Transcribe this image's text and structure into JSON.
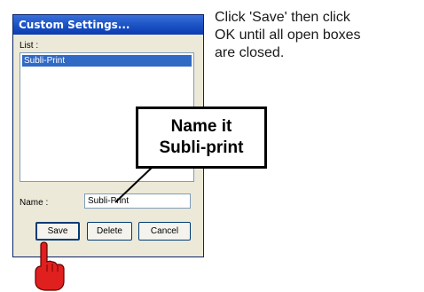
{
  "dialog": {
    "title": "Custom Settings...",
    "list_label": "List :",
    "list_items": [
      "Subli-Print"
    ],
    "name_label": "Name :",
    "name_value": "Subli-Print",
    "buttons": {
      "save": "Save",
      "delete": "Delete",
      "cancel": "Cancel"
    }
  },
  "instruction": {
    "lines": [
      "Click 'Save' then click",
      "OK until all open boxes",
      "are closed."
    ]
  },
  "callout": {
    "lines": [
      "Name it",
      "Subli-print"
    ]
  },
  "colors": {
    "titlebar": "#1f56c8",
    "selection": "#316ac5",
    "pointer_hand": "#e0201e"
  },
  "icons": {
    "pointer": "pointing-hand-icon"
  }
}
